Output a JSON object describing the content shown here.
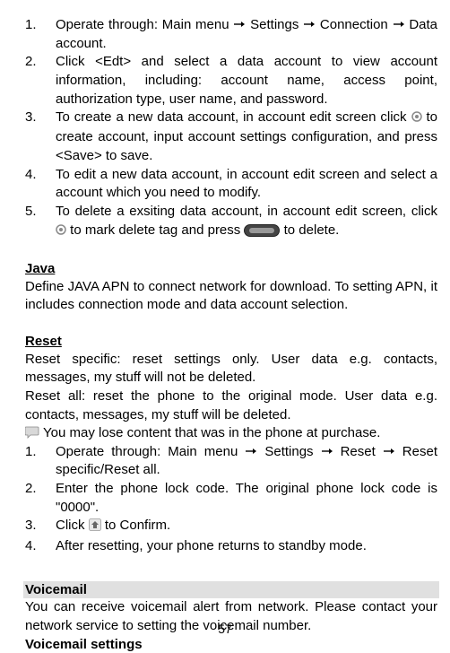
{
  "top_list": [
    {
      "num": "1.",
      "text_parts": [
        "Operate through: Main menu ",
        " Settings ",
        " Connection ",
        " Data account."
      ]
    },
    {
      "num": "2.",
      "text": "Click <Edt> and select a data account to view account information, including: account name, access point, authorization type, user name, and password."
    },
    {
      "num": "3.",
      "pre": "To create a new data account, in account edit screen click ",
      "post": " to create account, input account settings configuration, and press <Save> to save."
    },
    {
      "num": "4.",
      "text": "To edit a new data account, in account edit screen and select a account which you need to modify."
    },
    {
      "num": "5.",
      "pre": "To delete a exsiting data account, in account edit screen, click ",
      "mid": " to mark delete tag and press ",
      "post": " to delete."
    }
  ],
  "java": {
    "heading": "Java",
    "para": "Define JAVA APN to connect network for download. To setting APN, it includes connection mode and data account selection."
  },
  "reset": {
    "heading": "Reset",
    "para1": "Reset specific: reset settings only. User data e.g. contacts, messages, my stuff will not be deleted.",
    "para2": "Reset all: reset the phone to the original mode. User data e.g. contacts, messages, my stuff will be deleted.",
    "note": "You may lose content that was in the phone at purchase.",
    "list": [
      {
        "num": "1.",
        "text_parts": [
          "Operate through: Main menu ",
          " Settings ",
          " Reset ",
          " Reset specific/Reset all."
        ]
      },
      {
        "num": "2.",
        "text": "Enter the phone lock code. The original phone lock code is \"0000\"."
      },
      {
        "num": "3.",
        "pre": "Click ",
        "post": " to Confirm."
      },
      {
        "num": "4.",
        "text": "After resetting, your phone returns to standby mode."
      }
    ]
  },
  "voicemail": {
    "heading": "Voicemail",
    "para": "You can receive voicemail alert from network. Please contact your network service to setting the voicemail number.",
    "sub": "Voicemail settings"
  },
  "page_number": "57"
}
